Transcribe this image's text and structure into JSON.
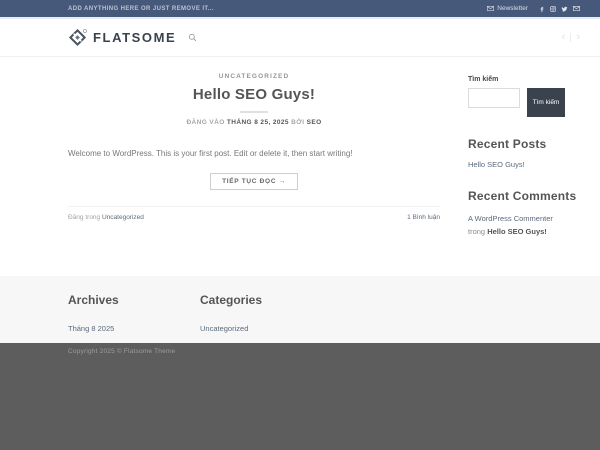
{
  "topbar": {
    "left_text": "ADD ANYTHING HERE OR JUST REMOVE IT...",
    "newsletter_label": "Newsletter",
    "social_icons": [
      "facebook-icon",
      "instagram-icon",
      "twitter-icon",
      "email-icon"
    ]
  },
  "header": {
    "logo_text": "FLATSOME",
    "prev_arrow": "‹",
    "next_arrow": "›"
  },
  "post": {
    "category": "UNCATEGORIZED",
    "title": "Hello SEO Guys!",
    "meta_prefix": "ĐĂNG VÀO",
    "meta_date": "THÁNG 8 25, 2025",
    "meta_by": "BỞI",
    "meta_author": "SEO",
    "excerpt": "Welcome to WordPress. This is your first post. Edit or delete it, then start writing!",
    "read_more": "TIẾP TỤC ĐỌC →",
    "posted_in": "Đăng trong",
    "category_link": "Uncategorized",
    "comments_link": "1 Bình luận"
  },
  "sidebar": {
    "search_label": "Tìm kiếm",
    "search_button": "Tìm kiếm",
    "recent_posts_title": "Recent Posts",
    "recent_posts": [
      "Hello SEO Guys!"
    ],
    "recent_comments_title": "Recent Comments",
    "comment_author": "A WordPress Commenter",
    "comment_in": "trong",
    "comment_post": "Hello SEO Guys!"
  },
  "footer": {
    "archives_title": "Archives",
    "archives_link": "Tháng 8 2025",
    "categories_title": "Categories",
    "categories_link": "Uncategorized",
    "copyright": "Copyright 2025 © Flatsome Theme"
  },
  "colors": {
    "topbar_bg": "#47597b",
    "dark_button_bg": "#39424d",
    "heading_text": "#555555",
    "link_text": "#5b6b7c",
    "footer_bg": "#f7f7f7",
    "absolute_footer_bg": "#5d5d5d"
  }
}
